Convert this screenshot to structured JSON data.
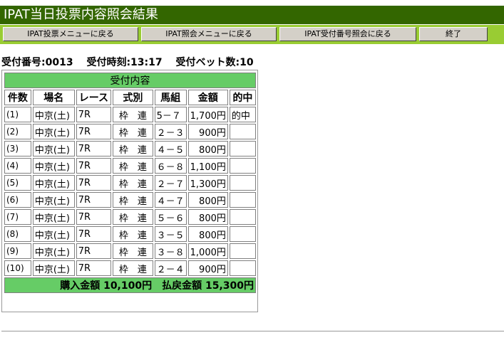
{
  "title": "IPAT当日投票内容照会結果",
  "menu": {
    "btn1": "IPAT投票メニューに戻る",
    "btn2": "IPAT照会メニューに戻る",
    "btn3": "IPAT受付番号照会に戻る",
    "btn4": "終了"
  },
  "info": {
    "receipt_no": "受付番号:0013",
    "receipt_time": "受付時刻:13:17",
    "bet_count": "受付ベット数:10"
  },
  "table": {
    "caption": "受付内容",
    "headers": [
      "件数",
      "場名",
      "レース",
      "式別",
      "馬組",
      "金額",
      "的中"
    ],
    "rows": [
      {
        "idx": "(1)",
        "venue": "中京(土)",
        "race": "7R",
        "type": "枠　連",
        "combo": "5－７",
        "amount": "1,700円",
        "hit": "的中"
      },
      {
        "idx": "(2)",
        "venue": "中京(土)",
        "race": "7R",
        "type": "枠　連",
        "combo": "２－３",
        "amount": "900円",
        "hit": ""
      },
      {
        "idx": "(3)",
        "venue": "中京(土)",
        "race": "7R",
        "type": "枠　連",
        "combo": "４－５",
        "amount": "800円",
        "hit": ""
      },
      {
        "idx": "(4)",
        "venue": "中京(土)",
        "race": "7R",
        "type": "枠　連",
        "combo": "６－８",
        "amount": "1,100円",
        "hit": ""
      },
      {
        "idx": "(5)",
        "venue": "中京(土)",
        "race": "7R",
        "type": "枠　連",
        "combo": "２－７",
        "amount": "1,300円",
        "hit": ""
      },
      {
        "idx": "(6)",
        "venue": "中京(土)",
        "race": "7R",
        "type": "枠　連",
        "combo": "４－７",
        "amount": "800円",
        "hit": ""
      },
      {
        "idx": "(7)",
        "venue": "中京(土)",
        "race": "7R",
        "type": "枠　連",
        "combo": "５－６",
        "amount": "800円",
        "hit": ""
      },
      {
        "idx": "(8)",
        "venue": "中京(土)",
        "race": "7R",
        "type": "枠　連",
        "combo": "３－５",
        "amount": "800円",
        "hit": ""
      },
      {
        "idx": "(9)",
        "venue": "中京(土)",
        "race": "7R",
        "type": "枠　連",
        "combo": "３－８",
        "amount": "1,000円",
        "hit": ""
      },
      {
        "idx": "(10)",
        "venue": "中京(土)",
        "race": "7R",
        "type": "枠　連",
        "combo": "２－４",
        "amount": "900円",
        "hit": ""
      }
    ],
    "total": "購入金額 10,100円　払戻金額 15,300円"
  },
  "colors": {
    "title_bg": "#336600",
    "menu_bg": "#99cc33",
    "table_accent": "#66cc66"
  }
}
